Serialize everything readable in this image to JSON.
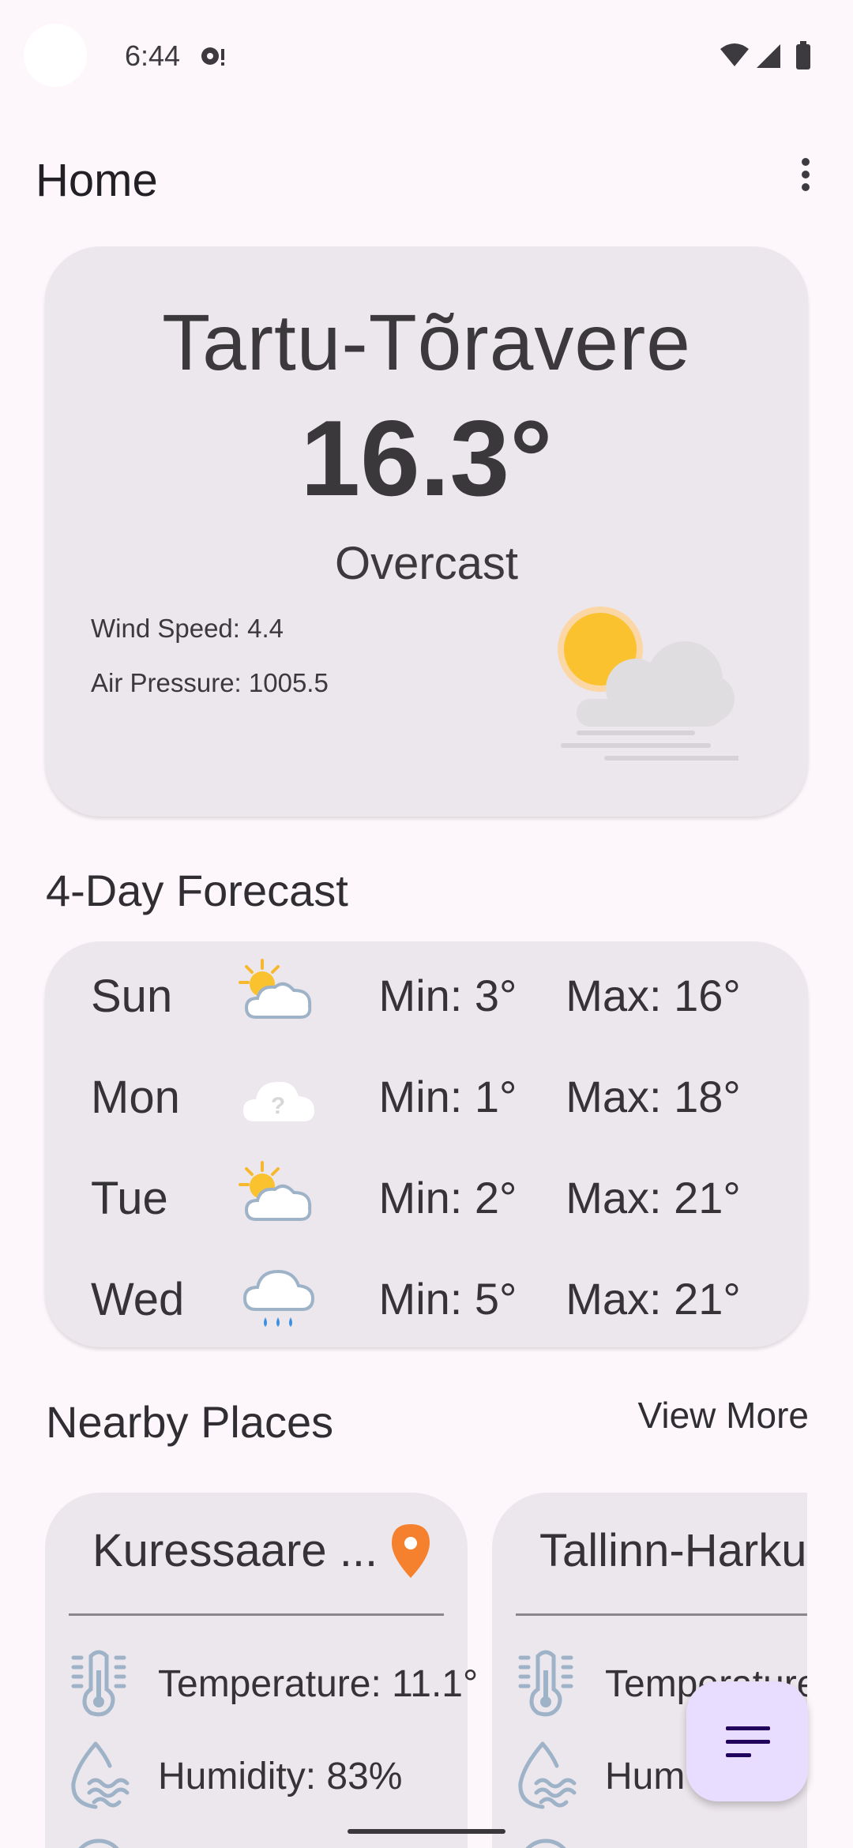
{
  "status_bar": {
    "time": "6:44"
  },
  "header": {
    "title": "Home"
  },
  "current": {
    "station": "Tartu-Tõravere",
    "temperature": "16.3°",
    "condition": "Overcast",
    "wind_speed": "Wind Speed: 4.4",
    "air_pressure": "Air Pressure: 1005.5",
    "icon": "sun-cloud-fog-icon"
  },
  "forecast": {
    "title": "4-Day Forecast",
    "days": [
      {
        "day": "Sun",
        "icon": "partly-sunny-icon",
        "min": "Min: 3°",
        "max": "Max: 16°"
      },
      {
        "day": "Mon",
        "icon": "unknown-cloud-icon",
        "min": "Min: 1°",
        "max": "Max: 18°"
      },
      {
        "day": "Tue",
        "icon": "partly-sunny-icon",
        "min": "Min: 2°",
        "max": "Max: 21°"
      },
      {
        "day": "Wed",
        "icon": "rain-cloud-icon",
        "min": "Min: 5°",
        "max": "Max: 21°"
      }
    ]
  },
  "nearby": {
    "title": "Nearby Places",
    "view_more": "View More",
    "places": [
      {
        "name": "Kuressaare ...",
        "temperature": "Temperature: 11.1°",
        "humidity": "Humidity: 83%"
      },
      {
        "name": "Tallinn-Harku",
        "temperature": "Temperature",
        "humidity": "Hum"
      }
    ]
  },
  "colors": {
    "accent_pin": "#f5802e",
    "fab_bg": "#e9ddff",
    "card_bg": "#ece7ec",
    "icon_blue": "#9fb3c8"
  }
}
